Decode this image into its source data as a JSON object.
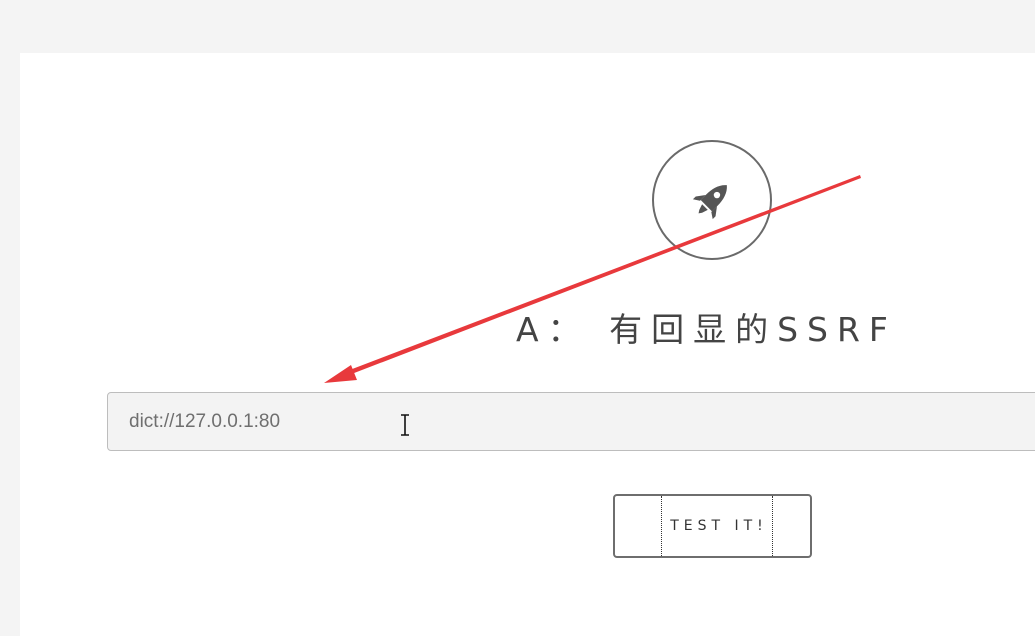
{
  "heading": "A： 有回显的SSRF",
  "url_input": {
    "value": "dict://127.0.0.1:80"
  },
  "test_button": {
    "label": "TEST IT!"
  },
  "icons": {
    "rocket": "rocket-icon",
    "cursor": "text-cursor-icon",
    "arrow": "annotation-arrow"
  },
  "colors": {
    "arrow": "#e8393c",
    "icon": "#555555"
  }
}
